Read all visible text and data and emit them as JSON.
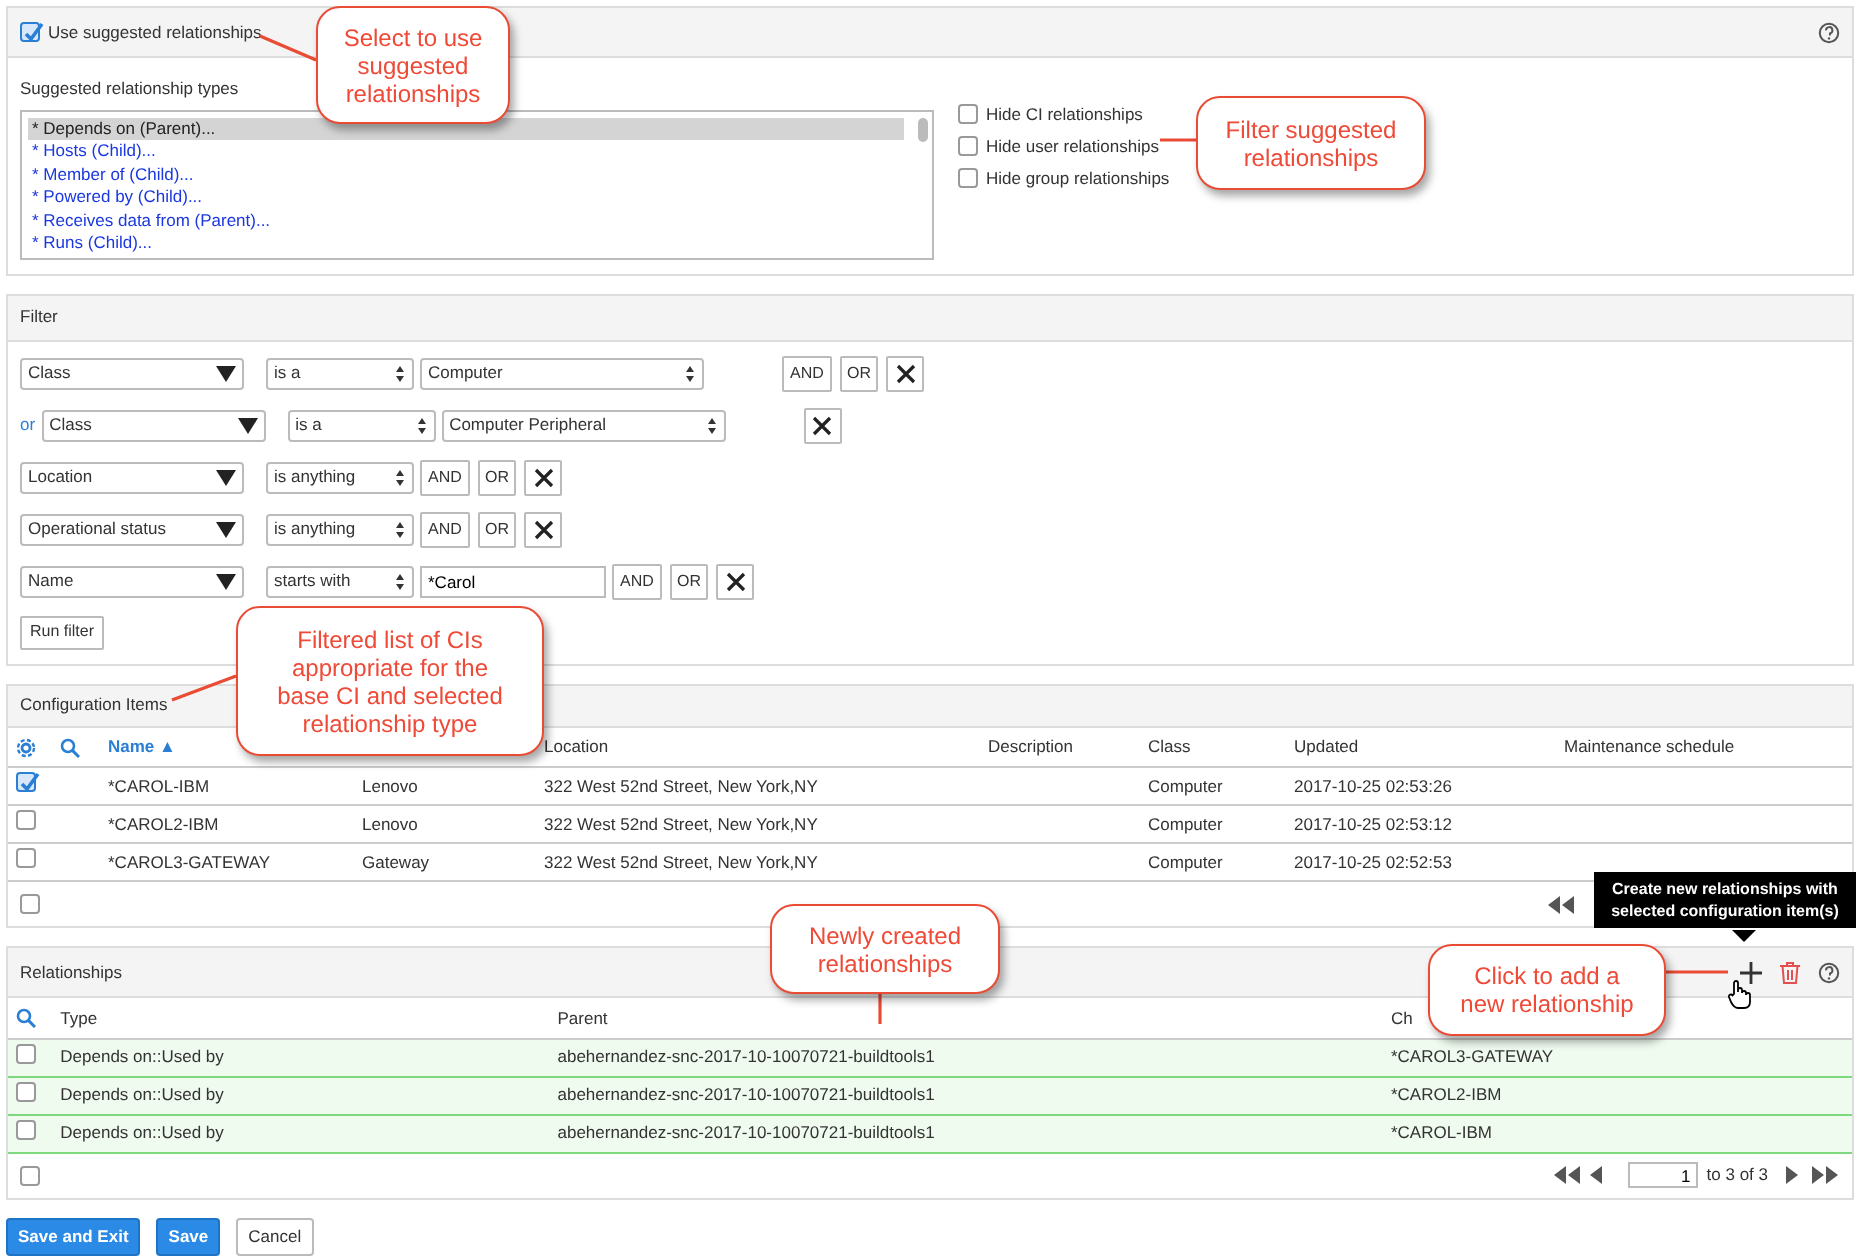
{
  "suggested": {
    "use_label": "Use suggested relationships",
    "use_checked": true,
    "types_label": "Suggested relationship types",
    "types": [
      {
        "label": "* Depends on (Parent)...",
        "selected": true
      },
      {
        "label": "* Hosts (Child)...",
        "selected": false
      },
      {
        "label": "* Member of (Child)...",
        "selected": false
      },
      {
        "label": "* Powered by (Child)...",
        "selected": false
      },
      {
        "label": "* Receives data from (Parent)...",
        "selected": false
      },
      {
        "label": "* Runs (Child)...",
        "selected": false
      }
    ],
    "hide_options": [
      {
        "label": "Hide CI relationships",
        "checked": false
      },
      {
        "label": "Hide user relationships",
        "checked": false
      },
      {
        "label": "Hide group relationships",
        "checked": false
      }
    ]
  },
  "filter": {
    "title": "Filter",
    "conditions": [
      {
        "field": "Class",
        "operator": "is a",
        "value": "Computer",
        "buttons": [
          "AND",
          "OR"
        ]
      },
      {
        "prefix": "or",
        "field": "Class",
        "operator": "is a",
        "value": "Computer Peripheral"
      },
      {
        "field": "Location",
        "operator": "is anything",
        "buttons": [
          "AND",
          "OR"
        ]
      },
      {
        "field": "Operational status",
        "operator": "is anything",
        "buttons": [
          "AND",
          "OR"
        ]
      },
      {
        "field": "Name",
        "operator": "starts with",
        "input_value": "*Carol",
        "buttons": [
          "AND",
          "OR"
        ]
      }
    ],
    "run_label": "Run filter"
  },
  "ci_table": {
    "title": "Configuration Items",
    "select_all_checked": false,
    "columns": [
      "Name",
      "",
      "Location",
      "Description",
      "Class",
      "Updated",
      "Maintenance schedule"
    ],
    "sort_mark": "▲",
    "rows": [
      {
        "checked": true,
        "cells": [
          "*CAROL-IBM",
          "Lenovo",
          "322 West 52nd Street, New York,NY",
          "",
          "Computer",
          "2017-10-25 02:53:26",
          ""
        ]
      },
      {
        "checked": false,
        "cells": [
          "*CAROL2-IBM",
          "Lenovo",
          "322 West 52nd Street, New York,NY",
          "",
          "Computer",
          "2017-10-25 02:53:12",
          ""
        ]
      },
      {
        "checked": false,
        "cells": [
          "*CAROL3-GATEWAY",
          "Gateway",
          "322 West 52nd Street, New York,NY",
          "",
          "Computer",
          "2017-10-25 02:52:53",
          ""
        ]
      }
    ]
  },
  "relationships": {
    "title": "Relationships",
    "select_all_checked": false,
    "columns": [
      "Type",
      "Parent",
      "Ch"
    ],
    "rows": [
      {
        "checked": false,
        "highlighted": true,
        "cells": [
          "Depends on::Used by",
          "abehernandez-snc-2017-10-10070721-buildtools1",
          "*CAROL3-GATEWAY"
        ]
      },
      {
        "checked": false,
        "highlighted": true,
        "cells": [
          "Depends on::Used by",
          "abehernandez-snc-2017-10-10070721-buildtools1",
          "*CAROL2-IBM"
        ]
      },
      {
        "checked": false,
        "highlighted": true,
        "cells": [
          "Depends on::Used by",
          "abehernandez-snc-2017-10-10070721-buildtools1",
          "*CAROL-IBM"
        ]
      }
    ],
    "pager": {
      "page": "1",
      "range": "to 3 of 3"
    }
  },
  "buttons": [
    {
      "label": "Save and Exit",
      "kind": "primary"
    },
    {
      "label": "Save",
      "kind": "primary"
    },
    {
      "label": "Cancel",
      "kind": "default"
    }
  ],
  "tooltip": "Create new relationships with selected configuration item(s)",
  "callouts": [
    {
      "text": "Select to use suggested relationships"
    },
    {
      "text": "Filter suggested relationships"
    },
    {
      "text": "Filtered list of CIs appropriate for the base CI and selected relationship type"
    },
    {
      "text": "Newly created relationships"
    },
    {
      "text": "Click to add a new relationship"
    }
  ]
}
